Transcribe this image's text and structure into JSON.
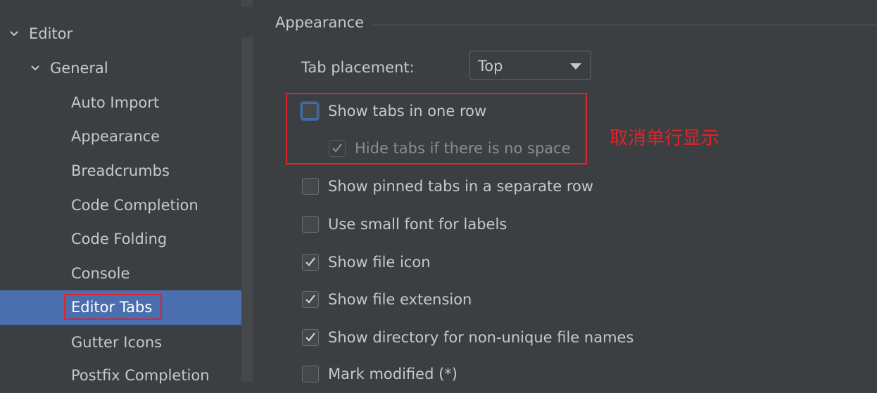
{
  "sidebar": {
    "items": [
      {
        "label": "Editor"
      },
      {
        "label": "General"
      },
      {
        "label": "Auto Import"
      },
      {
        "label": "Appearance"
      },
      {
        "label": "Breadcrumbs"
      },
      {
        "label": "Code Completion"
      },
      {
        "label": "Code Folding"
      },
      {
        "label": "Console"
      },
      {
        "label": "Editor Tabs",
        "selected": true
      },
      {
        "label": "Gutter Icons"
      },
      {
        "label": "Postfix Completion"
      }
    ]
  },
  "main": {
    "section_title": "Appearance",
    "tab_placement": {
      "label": "Tab placement:",
      "value": "Top"
    },
    "options": [
      {
        "label": "Show tabs in one row",
        "checked": false
      },
      {
        "label": "Hide tabs if there is no space",
        "checked": true,
        "disabled": true
      },
      {
        "label": "Show pinned tabs in a separate row",
        "checked": false
      },
      {
        "label": "Use small font for labels",
        "checked": false
      },
      {
        "label": "Show file icon",
        "checked": true
      },
      {
        "label": "Show file extension",
        "checked": true
      },
      {
        "label": "Show directory for non-unique file names",
        "checked": true
      },
      {
        "label": "Mark modified (*)",
        "checked": false
      }
    ],
    "annotation": "取消单行显示"
  },
  "colors": {
    "background": "#3c3f41",
    "selection": "#4b6eaf",
    "annotation_red": "#e0242b"
  }
}
